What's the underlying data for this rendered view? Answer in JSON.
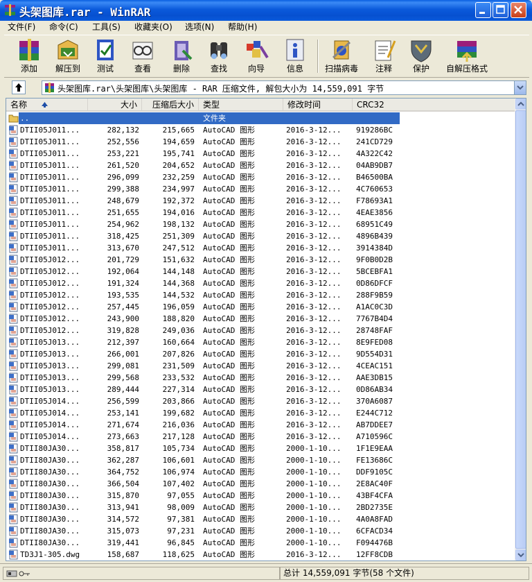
{
  "window": {
    "title": "头架图库.rar - WinRAR"
  },
  "menu": [
    {
      "label": "文件(F)"
    },
    {
      "label": "命令(C)"
    },
    {
      "label": "工具(S)"
    },
    {
      "label": "收藏夹(O)"
    },
    {
      "label": "选项(N)"
    },
    {
      "label": "帮助(H)"
    }
  ],
  "toolbar": [
    {
      "label": "添加",
      "icon": "add-archive-icon"
    },
    {
      "label": "解压到",
      "icon": "extract-to-icon"
    },
    {
      "label": "测试",
      "icon": "test-icon"
    },
    {
      "label": "查看",
      "icon": "view-icon"
    },
    {
      "label": "删除",
      "icon": "delete-icon"
    },
    {
      "label": "查找",
      "icon": "find-icon"
    },
    {
      "label": "向导",
      "icon": "wizard-icon"
    },
    {
      "label": "信息",
      "icon": "info-icon"
    },
    {
      "label": "扫描病毒",
      "icon": "virus-scan-icon"
    },
    {
      "label": "注释",
      "icon": "comment-icon"
    },
    {
      "label": "保护",
      "icon": "protect-icon"
    },
    {
      "label": "自解压格式",
      "icon": "sfx-icon"
    }
  ],
  "address": {
    "path": "头架图库.rar\\头架图库\\头架图库 - RAR 压缩文件, 解包大小为 14,559,091 字节"
  },
  "columns": [
    {
      "label": "名称"
    },
    {
      "label": "大小"
    },
    {
      "label": "压缩后大小"
    },
    {
      "label": "类型"
    },
    {
      "label": "修改时间"
    },
    {
      "label": "CRC32"
    }
  ],
  "parent_row": {
    "name": "..",
    "type": "文件夹"
  },
  "files": [
    {
      "name": "DTII05J011...",
      "size": "282,132",
      "packed": "215,665",
      "type": "AutoCAD 图形",
      "modified": "2016-3-12...",
      "crc": "919286BC"
    },
    {
      "name": "DTII05J011...",
      "size": "252,556",
      "packed": "194,659",
      "type": "AutoCAD 图形",
      "modified": "2016-3-12...",
      "crc": "241CD729"
    },
    {
      "name": "DTII05J011...",
      "size": "253,221",
      "packed": "195,741",
      "type": "AutoCAD 图形",
      "modified": "2016-3-12...",
      "crc": "4A322C42"
    },
    {
      "name": "DTII05J011...",
      "size": "261,520",
      "packed": "204,652",
      "type": "AutoCAD 图形",
      "modified": "2016-3-12...",
      "crc": "04AB9DB7"
    },
    {
      "name": "DTII05J011...",
      "size": "296,099",
      "packed": "232,259",
      "type": "AutoCAD 图形",
      "modified": "2016-3-12...",
      "crc": "B46500BA"
    },
    {
      "name": "DTII05J011...",
      "size": "299,388",
      "packed": "234,997",
      "type": "AutoCAD 图形",
      "modified": "2016-3-12...",
      "crc": "4C760653"
    },
    {
      "name": "DTII05J011...",
      "size": "248,679",
      "packed": "192,372",
      "type": "AutoCAD 图形",
      "modified": "2016-3-12...",
      "crc": "F78693A1"
    },
    {
      "name": "DTII05J011...",
      "size": "251,655",
      "packed": "194,016",
      "type": "AutoCAD 图形",
      "modified": "2016-3-12...",
      "crc": "4EAE3856"
    },
    {
      "name": "DTII05J011...",
      "size": "254,962",
      "packed": "198,132",
      "type": "AutoCAD 图形",
      "modified": "2016-3-12...",
      "crc": "68951C49"
    },
    {
      "name": "DTII05J011...",
      "size": "318,425",
      "packed": "251,309",
      "type": "AutoCAD 图形",
      "modified": "2016-3-12...",
      "crc": "4896B439"
    },
    {
      "name": "DTII05J011...",
      "size": "313,670",
      "packed": "247,512",
      "type": "AutoCAD 图形",
      "modified": "2016-3-12...",
      "crc": "3914384D"
    },
    {
      "name": "DTII05J012...",
      "size": "201,729",
      "packed": "151,632",
      "type": "AutoCAD 图形",
      "modified": "2016-3-12...",
      "crc": "9F0B0D2B"
    },
    {
      "name": "DTII05J012...",
      "size": "192,064",
      "packed": "144,148",
      "type": "AutoCAD 图形",
      "modified": "2016-3-12...",
      "crc": "5BCEBFA1"
    },
    {
      "name": "DTII05J012...",
      "size": "191,324",
      "packed": "144,368",
      "type": "AutoCAD 图形",
      "modified": "2016-3-12...",
      "crc": "0D86DFCF"
    },
    {
      "name": "DTII05J012...",
      "size": "193,535",
      "packed": "144,532",
      "type": "AutoCAD 图形",
      "modified": "2016-3-12...",
      "crc": "288F9B59"
    },
    {
      "name": "DTII05J012...",
      "size": "257,445",
      "packed": "196,059",
      "type": "AutoCAD 图形",
      "modified": "2016-3-12...",
      "crc": "A1AC0C3D"
    },
    {
      "name": "DTII05J012...",
      "size": "243,900",
      "packed": "188,820",
      "type": "AutoCAD 图形",
      "modified": "2016-3-12...",
      "crc": "7767B4D4"
    },
    {
      "name": "DTII05J012...",
      "size": "319,828",
      "packed": "249,036",
      "type": "AutoCAD 图形",
      "modified": "2016-3-12...",
      "crc": "28748FAF"
    },
    {
      "name": "DTII05J013...",
      "size": "212,397",
      "packed": "160,664",
      "type": "AutoCAD 图形",
      "modified": "2016-3-12...",
      "crc": "8E9FED08"
    },
    {
      "name": "DTII05J013...",
      "size": "266,001",
      "packed": "207,826",
      "type": "AutoCAD 图形",
      "modified": "2016-3-12...",
      "crc": "9D554D31"
    },
    {
      "name": "DTII05J013...",
      "size": "299,081",
      "packed": "231,509",
      "type": "AutoCAD 图形",
      "modified": "2016-3-12...",
      "crc": "4CEAC151"
    },
    {
      "name": "DTII05J013...",
      "size": "299,568",
      "packed": "233,532",
      "type": "AutoCAD 图形",
      "modified": "2016-3-12...",
      "crc": "AAE3DB15"
    },
    {
      "name": "DTII05J013...",
      "size": "289,444",
      "packed": "227,314",
      "type": "AutoCAD 图形",
      "modified": "2016-3-12...",
      "crc": "0D86AB34"
    },
    {
      "name": "DTII05J014...",
      "size": "256,599",
      "packed": "203,866",
      "type": "AutoCAD 图形",
      "modified": "2016-3-12...",
      "crc": "370A6087"
    },
    {
      "name": "DTII05J014...",
      "size": "253,141",
      "packed": "199,682",
      "type": "AutoCAD 图形",
      "modified": "2016-3-12...",
      "crc": "E244C712"
    },
    {
      "name": "DTII05J014...",
      "size": "271,674",
      "packed": "216,036",
      "type": "AutoCAD 图形",
      "modified": "2016-3-12...",
      "crc": "AB7DDEE7"
    },
    {
      "name": "DTII05J014...",
      "size": "273,663",
      "packed": "217,128",
      "type": "AutoCAD 图形",
      "modified": "2016-3-12...",
      "crc": "A710596C"
    },
    {
      "name": "DTII80JA30...",
      "size": "358,817",
      "packed": "105,734",
      "type": "AutoCAD 图形",
      "modified": "2000-1-10...",
      "crc": "1F1E9EAA"
    },
    {
      "name": "DTII80JA30...",
      "size": "362,287",
      "packed": "106,601",
      "type": "AutoCAD 图形",
      "modified": "2000-1-10...",
      "crc": "FE13686C"
    },
    {
      "name": "DTII80JA30...",
      "size": "364,752",
      "packed": "106,974",
      "type": "AutoCAD 图形",
      "modified": "2000-1-10...",
      "crc": "DDF9105C"
    },
    {
      "name": "DTII80JA30...",
      "size": "366,504",
      "packed": "107,402",
      "type": "AutoCAD 图形",
      "modified": "2000-1-10...",
      "crc": "2E8AC40F"
    },
    {
      "name": "DTII80JA30...",
      "size": "315,870",
      "packed": "97,055",
      "type": "AutoCAD 图形",
      "modified": "2000-1-10...",
      "crc": "43BF4CFA"
    },
    {
      "name": "DTII80JA30...",
      "size": "313,941",
      "packed": "98,009",
      "type": "AutoCAD 图形",
      "modified": "2000-1-10...",
      "crc": "2BD2735E"
    },
    {
      "name": "DTII80JA30...",
      "size": "314,572",
      "packed": "97,381",
      "type": "AutoCAD 图形",
      "modified": "2000-1-10...",
      "crc": "4A0A8FAD"
    },
    {
      "name": "DTII80JA30...",
      "size": "315,073",
      "packed": "97,231",
      "type": "AutoCAD 图形",
      "modified": "2000-1-10...",
      "crc": "6CFACD34"
    },
    {
      "name": "DTII80JA30...",
      "size": "319,441",
      "packed": "96,845",
      "type": "AutoCAD 图形",
      "modified": "2000-1-10...",
      "crc": "F094476B"
    },
    {
      "name": "TD3J1-305.dwg",
      "size": "158,687",
      "packed": "118,625",
      "type": "AutoCAD 图形",
      "modified": "2016-3-12...",
      "crc": "12FF8CDB"
    }
  ],
  "status": {
    "summary": "总计 14,559,091 字节(58 个文件)"
  },
  "colors": {
    "title_bar": "#0A5ADC",
    "selection": "#316AC5",
    "window_bg": "#ECE9D8"
  }
}
